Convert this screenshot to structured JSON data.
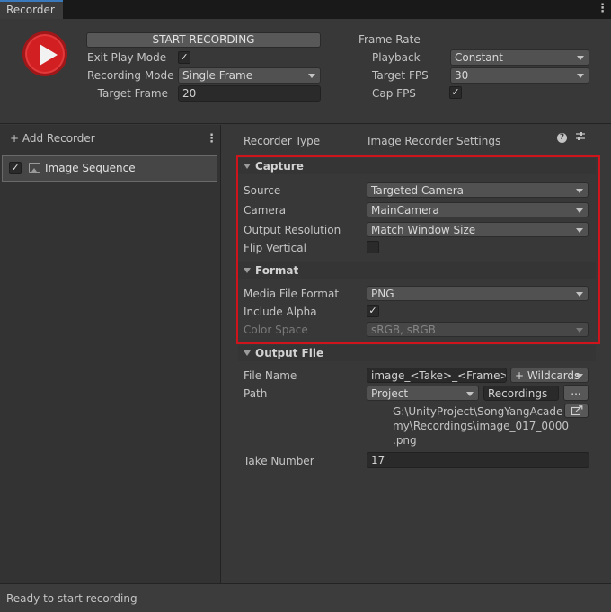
{
  "window": {
    "tab_title": "Recorder"
  },
  "top": {
    "start_button": "START RECORDING",
    "exit_play_mode": {
      "label": "Exit Play Mode",
      "checked": true
    },
    "recording_mode": {
      "label": "Recording Mode",
      "value": "Single Frame"
    },
    "target_frame": {
      "label": "Target Frame",
      "value": "20"
    },
    "frame_rate": {
      "heading": "Frame Rate",
      "playback": {
        "label": "Playback",
        "value": "Constant"
      },
      "target_fps": {
        "label": "Target FPS",
        "value": "30"
      },
      "cap_fps": {
        "label": "Cap FPS",
        "checked": true
      }
    }
  },
  "sidebar": {
    "add_recorder": "+ Add Recorder",
    "items": [
      {
        "label": "Image Sequence",
        "checked": true
      }
    ]
  },
  "inspector": {
    "recorder_type_label": "Recorder Type",
    "recorder_type_value": "Image Recorder Settings",
    "capture": {
      "heading": "Capture",
      "source": {
        "label": "Source",
        "value": "Targeted Camera"
      },
      "camera": {
        "label": "Camera",
        "value": "MainCamera"
      },
      "output_resolution": {
        "label": "Output Resolution",
        "value": "Match Window Size"
      },
      "flip_vertical": {
        "label": "Flip Vertical",
        "checked": false
      }
    },
    "format": {
      "heading": "Format",
      "media_file_format": {
        "label": "Media File Format",
        "value": "PNG"
      },
      "include_alpha": {
        "label": "Include Alpha",
        "checked": true
      },
      "color_space": {
        "label": "Color Space",
        "value": "sRGB, sRGB"
      }
    },
    "output_file": {
      "heading": "Output File",
      "file_name": {
        "label": "File Name",
        "value": "image_<Take>_<Frame>",
        "wildcards": "+ Wildcards"
      },
      "path": {
        "label": "Path",
        "root": "Project",
        "folder": "Recordings",
        "browse": "...",
        "full_path_line1": "G:\\UnityProject\\SongYangAcade",
        "full_path_line2": "my\\Recordings\\image_017_0000",
        "full_path_line3": ".png"
      },
      "take_number": {
        "label": "Take Number",
        "value": "17"
      }
    }
  },
  "status": {
    "text": "Ready to start recording"
  },
  "icons": {
    "play": "play-icon",
    "help": "help-icon",
    "presets": "preset-sliders-icon",
    "menu": "kebab-menu-icon",
    "image": "image-icon",
    "open_folder": "open-external-icon"
  },
  "colors": {
    "record_red": "#d21f22",
    "highlight_box": "#d0141c",
    "tab_accent": "#3a79bb"
  }
}
